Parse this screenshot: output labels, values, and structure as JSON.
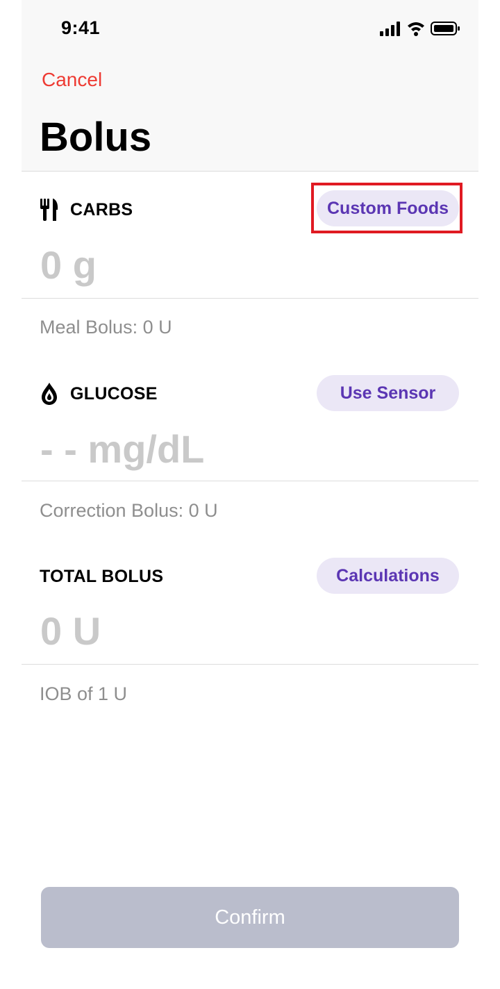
{
  "status_bar": {
    "time": "9:41"
  },
  "nav": {
    "cancel_label": "Cancel",
    "title": "Bolus"
  },
  "carbs": {
    "label": "CARBS",
    "icon": "fork-knife-icon",
    "button_label": "Custom Foods",
    "value": "0 g",
    "sub_text": "Meal Bolus: 0 U"
  },
  "glucose": {
    "label": "GLUCOSE",
    "icon": "drop-icon",
    "button_label": "Use Sensor",
    "value": "- - mg/dL",
    "sub_text": "Correction Bolus: 0 U"
  },
  "total": {
    "label": "TOTAL BOLUS",
    "button_label": "Calculations",
    "value": "0 U",
    "sub_text": "IOB of 1 U"
  },
  "footer": {
    "confirm_label": "Confirm"
  },
  "colors": {
    "accent": "#5b36b3",
    "pill_background": "#ebe7f6",
    "cancel": "#ee3b33",
    "highlight": "#e01a22",
    "disabled_button": "#babdcc"
  }
}
